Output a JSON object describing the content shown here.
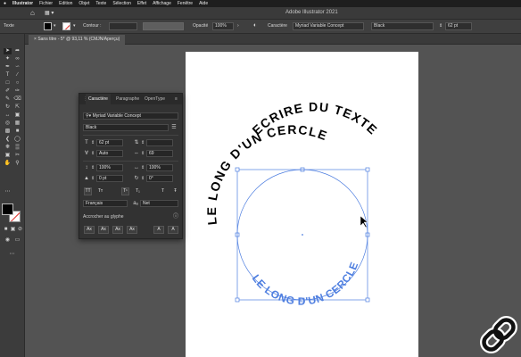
{
  "menubar": {
    "apple": "",
    "items": [
      "Illustrator",
      "Fichier",
      "Edition",
      "Objet",
      "Texte",
      "Sélection",
      "Effet",
      "Affichage",
      "Fenêtre",
      "Aide"
    ]
  },
  "appbar": {
    "home_icon": "home-icon",
    "window_title": "Adobe Illustrator 2021"
  },
  "controlbar": {
    "mode_label": "Texte",
    "stroke_label": "Contour :",
    "opacity_label": "Opacité",
    "opacity_value": "100%",
    "char_label": "Caractère",
    "font_value": "Myriad Variable Concept",
    "style_value": "Black",
    "size_value": "62 pt"
  },
  "document_tab": {
    "label": "Sans titre - 5* @ 93,11 % (CMJN/Aperçu)",
    "close": "×"
  },
  "character_panel": {
    "tabs": [
      "Caractère",
      "Paragraphe",
      "OpenType"
    ],
    "active_tab": "Caractère",
    "search_icon": "search-icon",
    "font_family": "Myriad Variable Concept",
    "font_style": "Black",
    "font_size": "62 pt",
    "leading": "",
    "kerning": "Auto",
    "tracking": "69",
    "vertical_scale": "100%",
    "horizontal_scale": "100%",
    "baseline_shift": "0 pt",
    "rotation": "0°",
    "style_buttons": [
      "TT",
      "Tт",
      "T¹",
      "T₁",
      "T",
      "Ŧ"
    ],
    "language": "Français",
    "antialias": "Net",
    "snap_label": "Accrocher au glyphe",
    "snap_buttons": [
      "Ax",
      "Ax",
      "Ax",
      "Ax",
      "A",
      "A"
    ]
  },
  "artboard": {
    "text_top": "ECRIRE DU TEXTE",
    "text_circle": "LE LONG D'UN CERCLE",
    "text_circle_inner": "LE LONG D'UN CERCLE",
    "text_color": "#000000",
    "selection_color": "#4f7fe0"
  },
  "colors": {
    "ui_background": "#535353",
    "panel_background": "#323232",
    "accent_blue": "#4f7fe0"
  },
  "logo": {
    "icon": "chain-link-icon"
  }
}
